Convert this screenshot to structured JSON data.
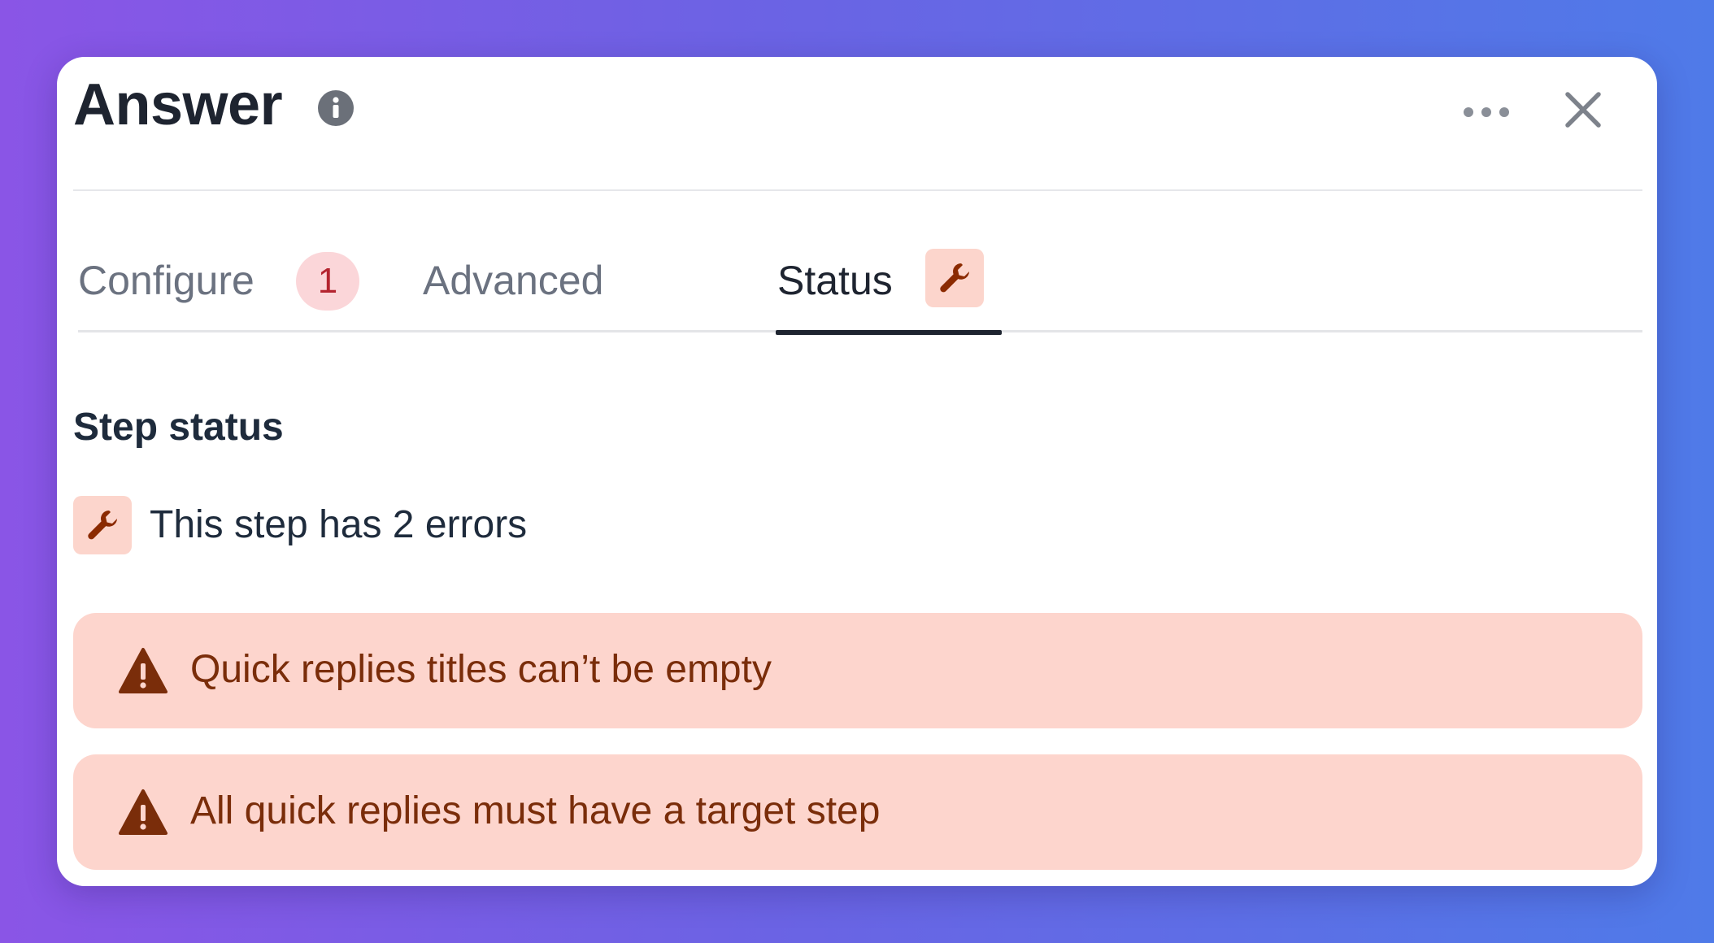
{
  "header": {
    "title": "Answer",
    "info_icon": "info-icon",
    "more_icon": "more-horizontal-icon",
    "close_icon": "close-icon"
  },
  "tabs": [
    {
      "label": "Configure",
      "badge": "1",
      "active": false
    },
    {
      "label": "Advanced",
      "active": false
    },
    {
      "label": "Status",
      "badge_icon": "wrench-icon",
      "active": true
    }
  ],
  "status": {
    "section_title": "Step status",
    "summary": "This step has 2 errors",
    "summary_icon": "wrench-icon"
  },
  "errors": [
    {
      "icon": "warning-icon",
      "text": "Quick replies titles can’t be empty"
    },
    {
      "icon": "warning-icon",
      "text": "All quick replies must have a target step"
    }
  ],
  "colors": {
    "error_bg": "#fdd5cd",
    "error_text": "#7a2d0a",
    "badge_bg": "#fbd6d9",
    "badge_text": "#b4242f",
    "wrench_bg": "#fcd5cc",
    "wrench_color": "#8b2a00"
  }
}
